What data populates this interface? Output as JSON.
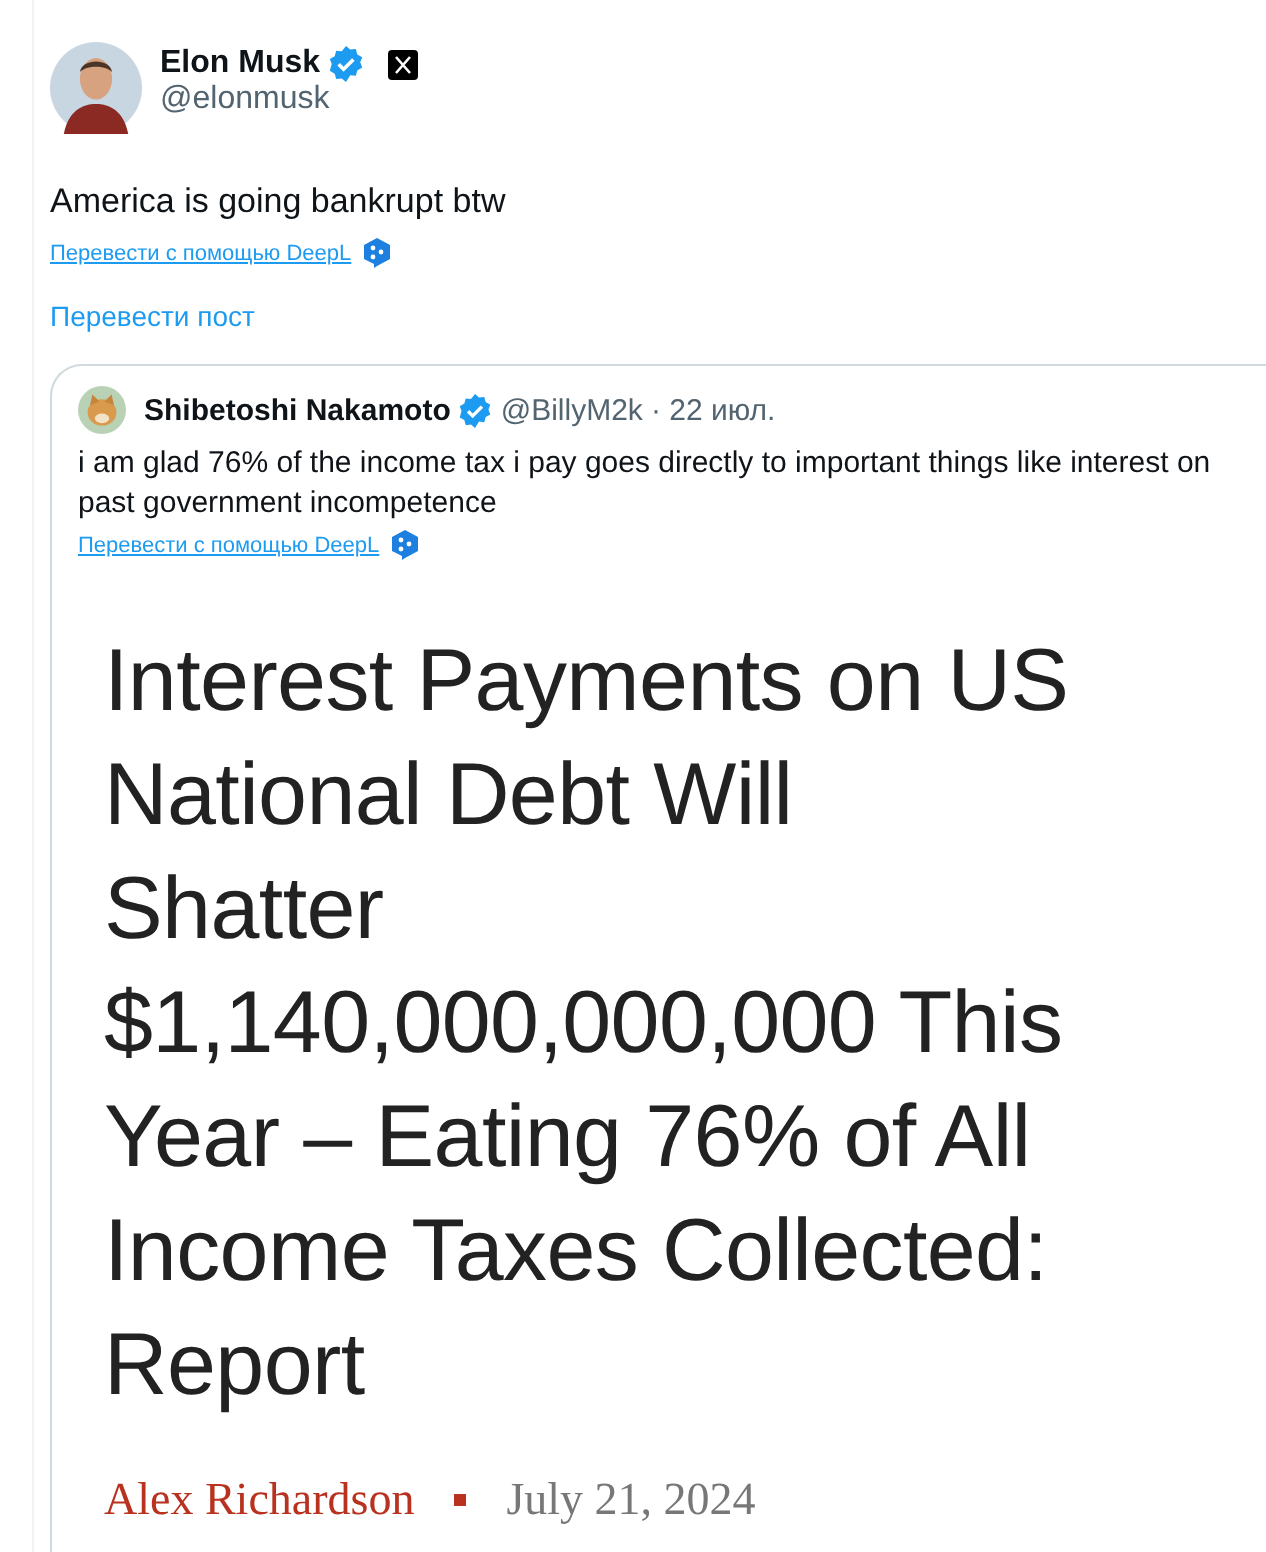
{
  "post": {
    "author": {
      "name": "Elon Musk",
      "handle": "@elonmusk",
      "verified": true
    },
    "text": "America is going bankrupt btw",
    "deepl_link": "Перевести с помощью DeepL",
    "translate_link": "Перевести пост",
    "quote": {
      "author": {
        "name": "Shibetoshi Nakamoto",
        "handle": "@BillyM2k",
        "date": "· 22 июл.",
        "verified": true
      },
      "text": "i am glad 76% of the income tax i pay goes directly to important things like interest on past government incompetence",
      "deepl_link": "Перевести с помощью DeepL",
      "article": {
        "headline": "Interest Payments on US\nNational Debt Will\nShatter\n$1,140,000,000,000 This\nYear – Eating 76% of All\nIncome Taxes Collected:\nReport",
        "byline": "Alex Richardson",
        "date": "July 21, 2024"
      }
    }
  }
}
